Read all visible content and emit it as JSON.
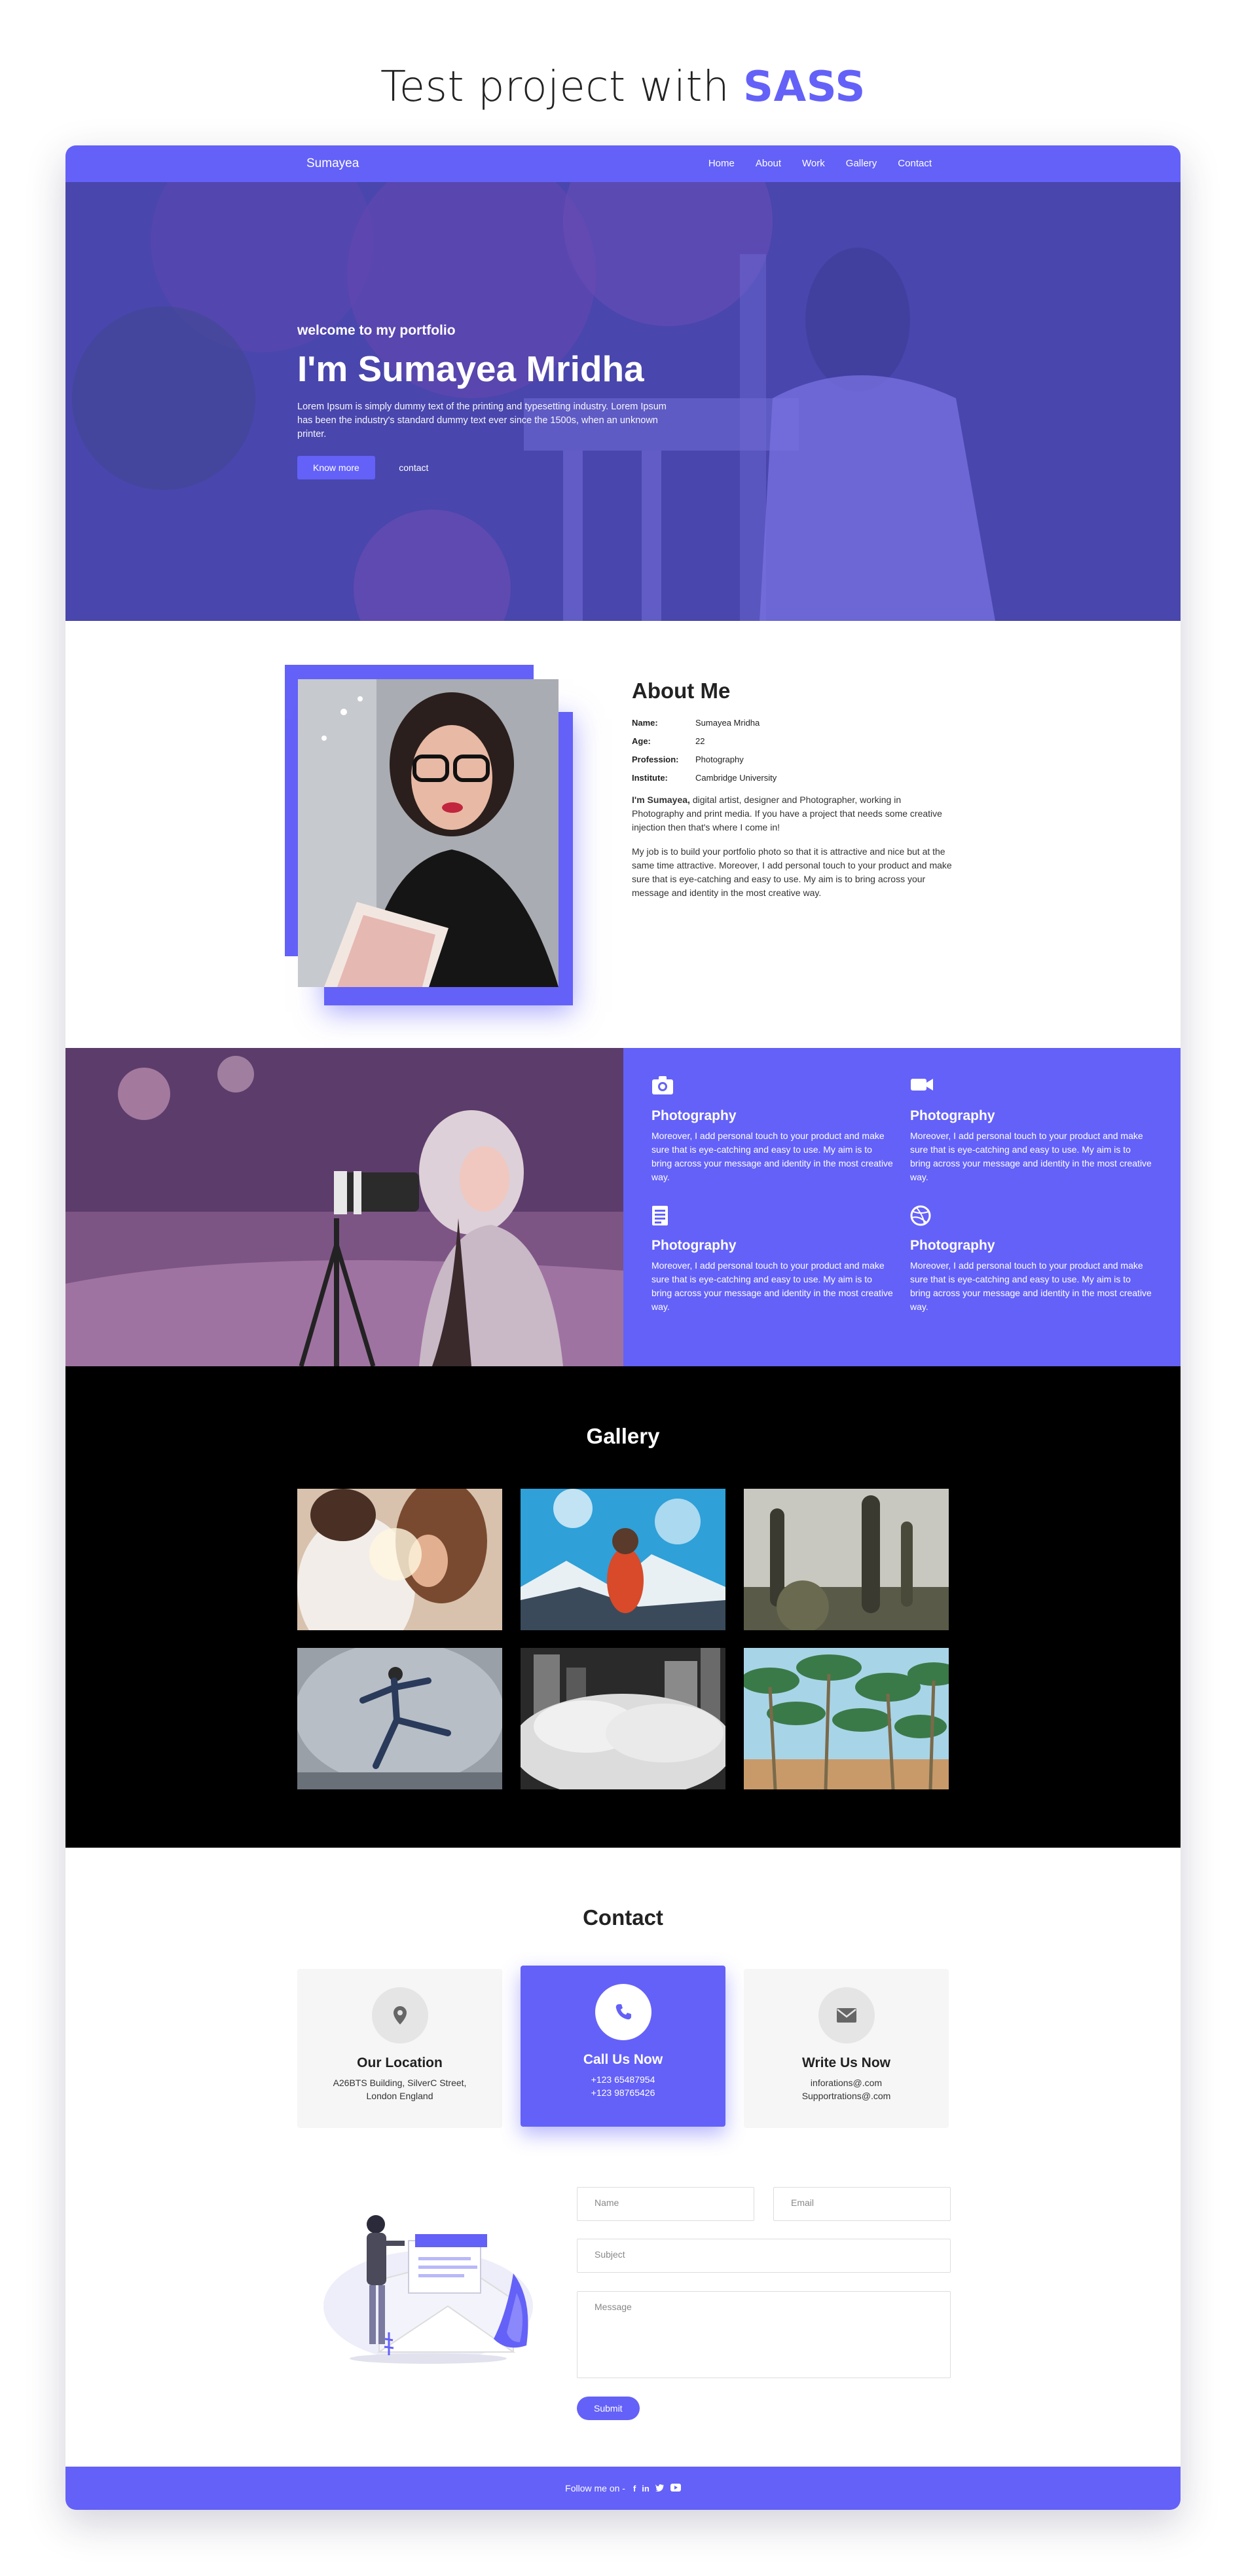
{
  "page_heading": {
    "prefix": "Test project with",
    "accent": "SASS"
  },
  "nav": {
    "brand": "Sumayea",
    "links": [
      "Home",
      "About",
      "Work",
      "Gallery",
      "Contact"
    ]
  },
  "hero": {
    "welcome": "welcome to my portfolio",
    "name": "I'm Sumayea Mridha",
    "text": "Lorem Ipsum is simply dummy text of the printing and typesetting industry. Lorem Ipsum has been the industry's standard dummy text ever since the 1500s, when an unknown printer.",
    "primary_button": "Know more",
    "secondary_button": "contact"
  },
  "about": {
    "title": "About Me",
    "info": [
      {
        "key": "Name:",
        "value": "Sumayea Mridha"
      },
      {
        "key": "Age:",
        "value": "22"
      },
      {
        "key": "Profession:",
        "value": "Photography"
      },
      {
        "key": "Institute:",
        "value": "Cambridge University"
      }
    ],
    "p1_bold": "I'm Sumayea,",
    "p1_rest": " digital artist, designer and Photographer, working in Photography and print media. If you have a project that needs some creative injection then that's where I come in!",
    "p2": "My job is to build your portfolio photo so that it is attractive and nice but at the same time attractive. Moreover, I add personal touch to your product and make sure that is eye-catching and easy to use. My aim is to bring across your message and identity in the most creative way."
  },
  "services": [
    {
      "icon": "camera-icon",
      "title": "Photography",
      "text": "Moreover, I add personal touch to your product and make sure that is eye-catching and easy to use. My aim is to bring across your message and identity in the most creative way."
    },
    {
      "icon": "video-camera-icon",
      "title": "Photography",
      "text": "Moreover, I add personal touch to your product and make sure that is eye-catching and easy to use. My aim is to bring across your message and identity in the most creative way."
    },
    {
      "icon": "document-icon",
      "title": "Photography",
      "text": "Moreover, I add personal touch to your product and make sure that is eye-catching and easy to use. My aim is to bring across your message and identity in the most creative way."
    },
    {
      "icon": "dribbble-icon",
      "title": "Photography",
      "text": "Moreover, I add personal touch to your product and make sure that is eye-catching and easy to use. My aim is to bring across your message and identity in the most creative way."
    }
  ],
  "gallery": {
    "title": "Gallery",
    "images": [
      "couple-photo",
      "mountain-hiker-photo",
      "cactus-photo",
      "dancer-photo",
      "city-fog-photo",
      "palm-trees-photo"
    ]
  },
  "contact": {
    "title": "Contact",
    "cards": [
      {
        "icon": "location-pin-icon",
        "title": "Our Location",
        "lines": [
          "A26BTS Building, SilverC Street,",
          "London England"
        ]
      },
      {
        "icon": "phone-icon",
        "title": "Call Us Now",
        "lines": [
          "+123 65487954",
          "+123 98765426"
        ]
      },
      {
        "icon": "envelope-icon",
        "title": "Write Us Now",
        "lines": [
          "inforations@.com",
          "Supportrations@.com"
        ]
      }
    ],
    "form": {
      "name_placeholder": "Name",
      "email_placeholder": "Email",
      "subject_placeholder": "Subject",
      "message_placeholder": "Message",
      "submit_label": "Submit"
    }
  },
  "footer": {
    "text": "Follow me on -",
    "social_icons": [
      "facebook-icon",
      "linkedin-icon",
      "twitter-icon",
      "youtube-icon"
    ]
  },
  "colors": {
    "accent": "#6461f8",
    "dark": "#000000",
    "card_bg": "#f6f6f6"
  }
}
